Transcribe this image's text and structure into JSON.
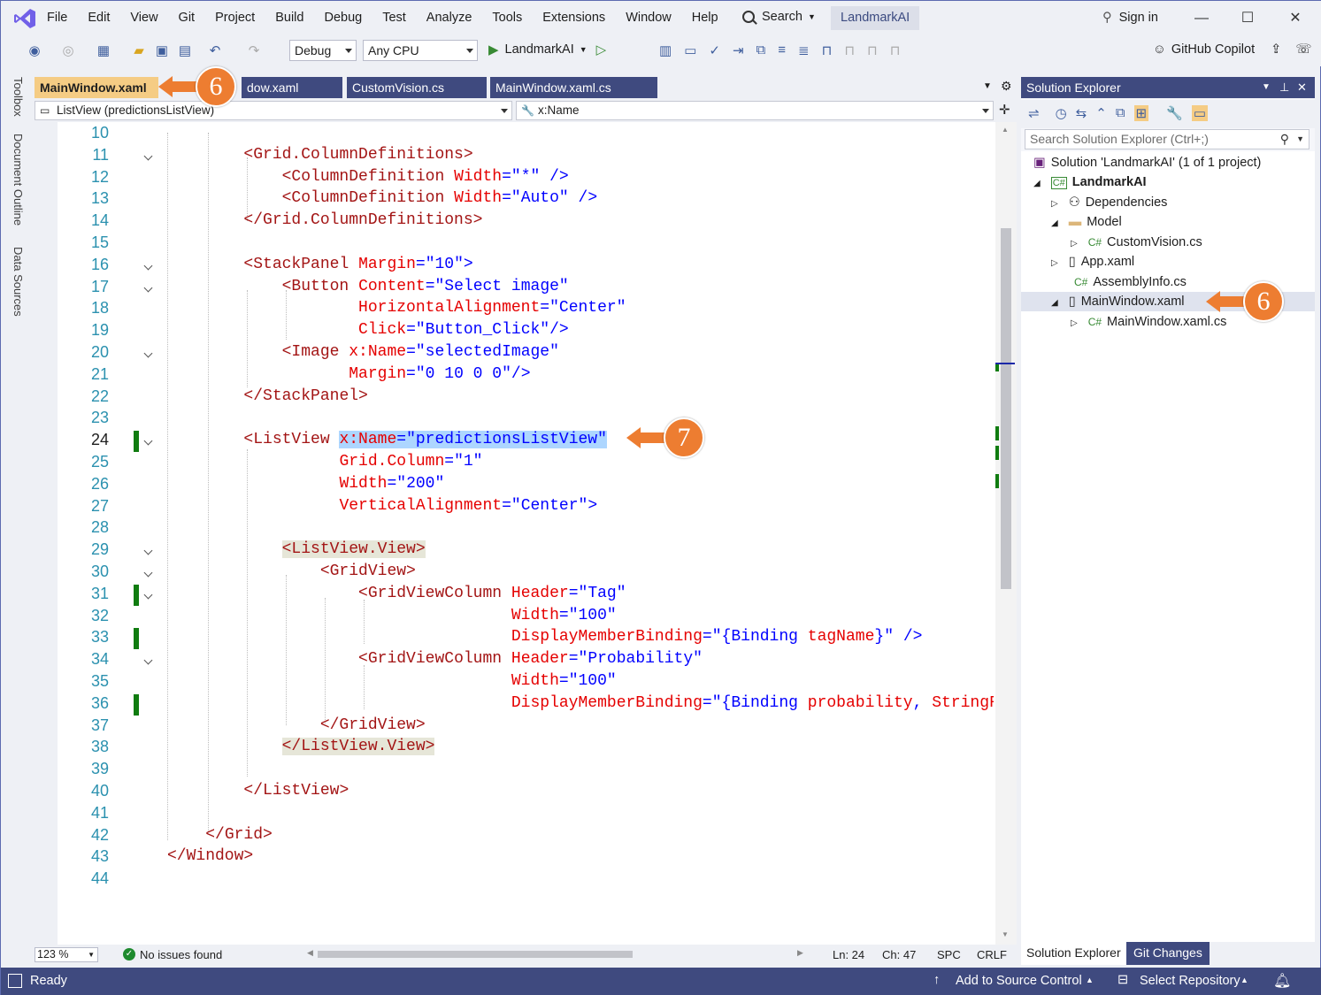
{
  "menu": [
    "File",
    "Edit",
    "View",
    "Git",
    "Project",
    "Build",
    "Debug",
    "Test",
    "Analyze",
    "Tools",
    "Extensions",
    "Window",
    "Help"
  ],
  "search_label": "Search",
  "project_name": "LandmarkAI",
  "sign_in": "Sign in",
  "toolbar": {
    "config": "Debug",
    "platform": "Any CPU",
    "run_target": "LandmarkAI",
    "copilot": "GitHub Copilot"
  },
  "left_strip": [
    "Toolbox",
    "Document Outline",
    "Data Sources"
  ],
  "tabs": [
    {
      "label": "MainWindow.xaml",
      "active": true
    },
    {
      "label": "dow.xaml",
      "active": false
    },
    {
      "label": "CustomVision.cs",
      "active": false
    },
    {
      "label": "MainWindow.xaml.cs",
      "active": false
    }
  ],
  "nav": {
    "left": "ListView (predictionsListView)",
    "right": "x:Name"
  },
  "code_lines": [
    {
      "n": "10",
      "html": ""
    },
    {
      "n": "11",
      "html": "        <span class='tg'>&lt;Grid.ColumnDefinitions&gt;</span>"
    },
    {
      "n": "12",
      "html": "            <span class='tg'>&lt;ColumnDefinition</span> <span class='at'>Width</span><span class='pn'>=</span><span class='vl'>\"*\"</span> <span class='pn'>/&gt;</span>"
    },
    {
      "n": "13",
      "html": "            <span class='tg'>&lt;ColumnDefinition</span> <span class='at'>Width</span><span class='pn'>=</span><span class='vl'>\"Auto\"</span> <span class='pn'>/&gt;</span>"
    },
    {
      "n": "14",
      "html": "        <span class='tg'>&lt;/Grid.ColumnDefinitions&gt;</span>"
    },
    {
      "n": "15",
      "html": ""
    },
    {
      "n": "16",
      "html": "        <span class='tg'>&lt;StackPanel</span> <span class='at'>Margin</span><span class='pn'>=</span><span class='vl'>\"10\"</span><span class='pn'>&gt;</span>"
    },
    {
      "n": "17",
      "html": "            <span class='tg'>&lt;Button</span> <span class='at'>Content</span><span class='pn'>=</span><span class='vl'>\"Select image\"</span>"
    },
    {
      "n": "18",
      "html": "                    <span class='at'>HorizontalAlignment</span><span class='pn'>=</span><span class='vl'>\"Center\"</span>"
    },
    {
      "n": "19",
      "html": "                    <span class='at'>Click</span><span class='pn'>=</span><span class='vl'>\"Button_Click\"</span><span class='pn'>/&gt;</span>"
    },
    {
      "n": "20",
      "html": "            <span class='tg'>&lt;Image</span> <span class='at'>x:Name</span><span class='pn'>=</span><span class='vl'>\"selectedImage\"</span>"
    },
    {
      "n": "21",
      "html": "                   <span class='at'>Margin</span><span class='pn'>=</span><span class='vl'>\"0 10 0 0\"</span><span class='pn'>/&gt;</span>"
    },
    {
      "n": "22",
      "html": "        <span class='tg'>&lt;/StackPanel&gt;</span>"
    },
    {
      "n": "23",
      "html": ""
    },
    {
      "n": "24",
      "html": "        <span class='tg'>&lt;ListView</span> <span style='background:#add6ff'><span class='at'>x:Name</span><span class='pn'>=</span><span class='vl'>\"predictionsListView\"</span></span>"
    },
    {
      "n": "25",
      "html": "                  <span class='at'>Grid.Column</span><span class='pn'>=</span><span class='vl'>\"1\"</span>"
    },
    {
      "n": "26",
      "html": "                  <span class='at'>Width</span><span class='pn'>=</span><span class='vl'>\"200\"</span>"
    },
    {
      "n": "27",
      "html": "                  <span class='at'>VerticalAlignment</span><span class='pn'>=</span><span class='vl'>\"Center\"</span><span class='pn'>&gt;</span>"
    },
    {
      "n": "28",
      "html": ""
    },
    {
      "n": "29",
      "html": "            <span class='tg' style='background:#e6e6d8'>&lt;ListView.View&gt;</span>"
    },
    {
      "n": "30",
      "html": "                <span class='tg'>&lt;GridView&gt;</span>"
    },
    {
      "n": "31",
      "html": "                    <span class='tg'>&lt;GridViewColumn</span> <span class='at'>Header</span><span class='pn'>=</span><span class='vl'>\"Tag\"</span>"
    },
    {
      "n": "32",
      "html": "                                    <span class='at'>Width</span><span class='pn'>=</span><span class='vl'>\"100\"</span>"
    },
    {
      "n": "33",
      "html": "                                    <span class='at'>DisplayMemberBinding</span><span class='pn'>=</span><span class='vl'>\"{Binding <span class='at'>tagName</span>}\"</span> <span class='pn'>/&gt;</span>"
    },
    {
      "n": "34",
      "html": "                    <span class='tg'>&lt;GridViewColumn</span> <span class='at'>Header</span><span class='pn'>=</span><span class='vl'>\"Probability\"</span>"
    },
    {
      "n": "35",
      "html": "                                    <span class='at'>Width</span><span class='pn'>=</span><span class='vl'>\"100\"</span>"
    },
    {
      "n": "36",
      "html": "                                    <span class='at'>DisplayMemberBinding</span><span class='pn'>=</span><span class='vl'>\"{Binding <span class='at'>probability</span>, <span class='at'>StringFormat</span></span>"
    },
    {
      "n": "37",
      "html": "                <span class='tg'>&lt;/GridView&gt;</span>"
    },
    {
      "n": "38",
      "html": "            <span class='tg' style='background:#e6e6d8'>&lt;/ListView.View&gt;</span>"
    },
    {
      "n": "39",
      "html": ""
    },
    {
      "n": "40",
      "html": "        <span class='tg'>&lt;/ListView&gt;</span>"
    },
    {
      "n": "41",
      "html": ""
    },
    {
      "n": "42",
      "html": "    <span class='tg'>&lt;/Grid&gt;</span>"
    },
    {
      "n": "43",
      "html": "<span class='tg'>&lt;/Window&gt;</span>"
    },
    {
      "n": "44",
      "html": ""
    }
  ],
  "editor_status": {
    "zoom": "123 %",
    "issues": "No issues found",
    "ln": "Ln: 24",
    "ch": "Ch: 47",
    "enc": "SPC",
    "eol": "CRLF"
  },
  "solution_explorer": {
    "title": "Solution Explorer",
    "search_placeholder": "Search Solution Explorer (Ctrl+;)",
    "nodes": [
      {
        "label": "Solution 'LandmarkAI' (1 of 1 project)",
        "icon": "solution-icon"
      },
      {
        "label": "LandmarkAI",
        "icon": "csharp-project-icon"
      },
      {
        "label": "Dependencies",
        "icon": "dependencies-icon"
      },
      {
        "label": "Model",
        "icon": "folder-icon"
      },
      {
        "label": "CustomVision.cs",
        "icon": "csharp-file-icon"
      },
      {
        "label": "App.xaml",
        "icon": "xaml-file-icon"
      },
      {
        "label": "AssemblyInfo.cs",
        "icon": "csharp-file-icon"
      },
      {
        "label": "MainWindow.xaml",
        "icon": "xaml-file-icon"
      },
      {
        "label": "MainWindow.xaml.cs",
        "icon": "csharp-file-icon"
      }
    ],
    "bottom_tabs": [
      "Solution Explorer",
      "Git Changes"
    ]
  },
  "statusbar": {
    "ready": "Ready",
    "add_source": "Add to Source Control",
    "select_repo": "Select Repository"
  },
  "callouts": [
    "6",
    "6",
    "7"
  ],
  "colors": {
    "accent": "#3f4a7f",
    "callout": "#ed7d31",
    "active_tab": "#f5cc84"
  }
}
